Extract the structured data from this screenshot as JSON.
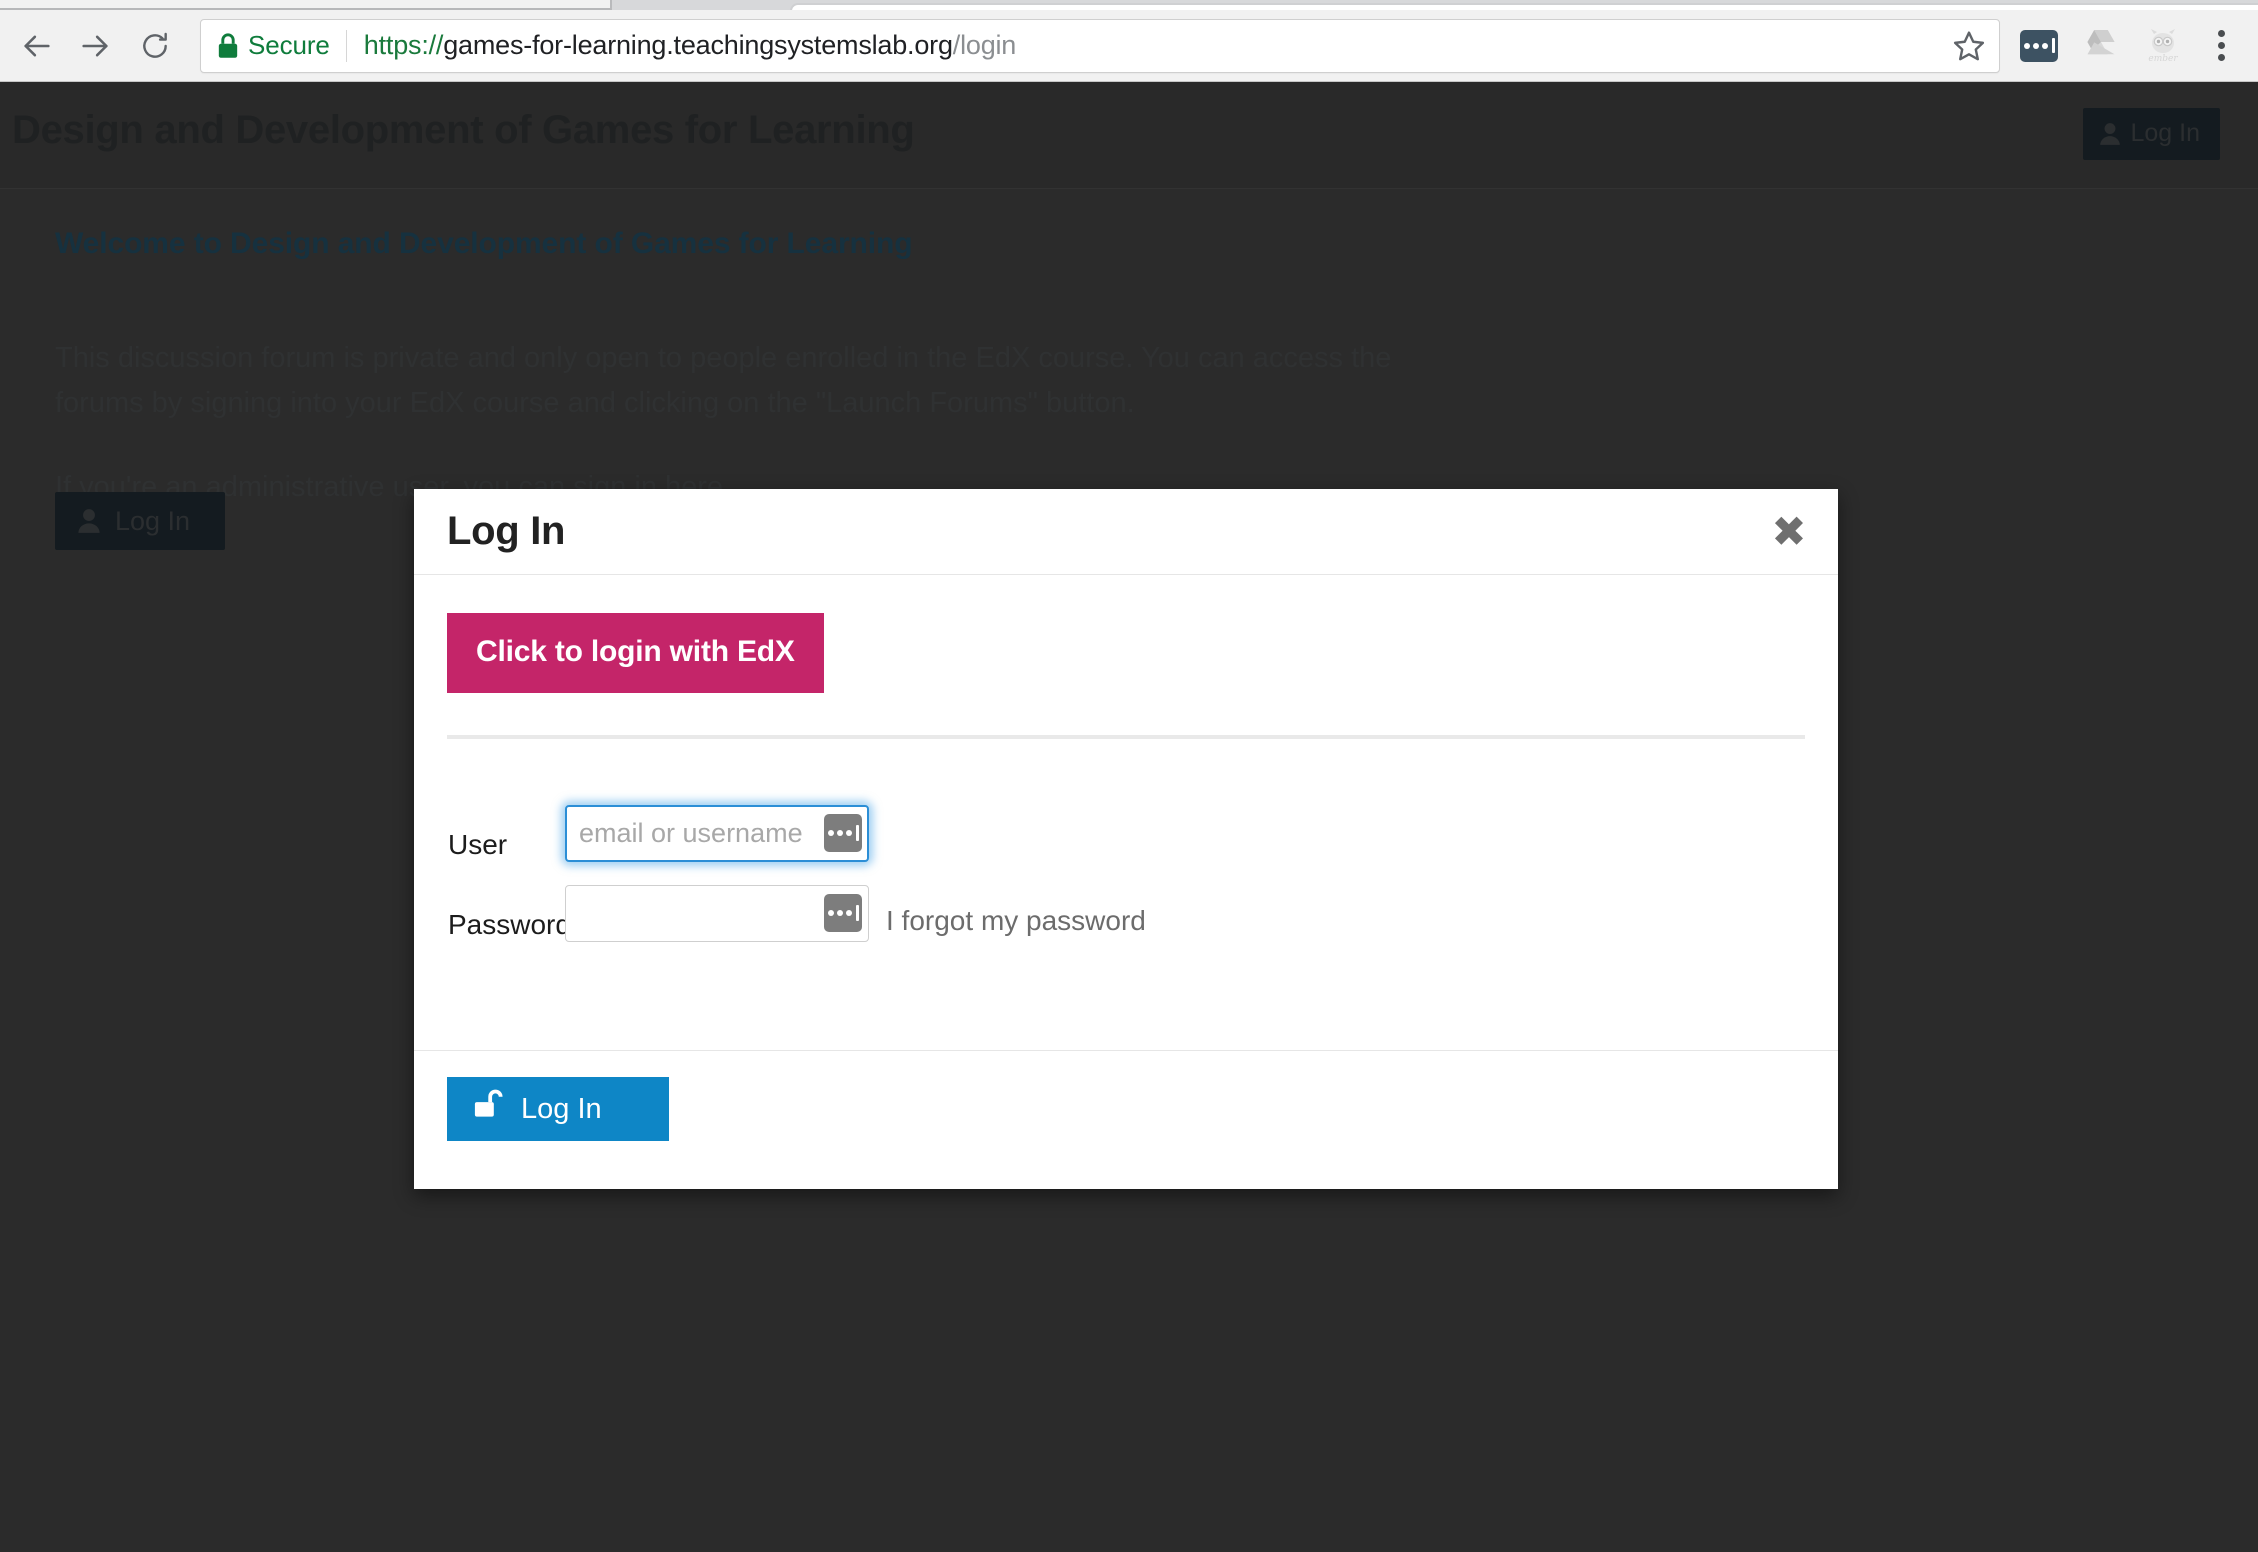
{
  "browser": {
    "back_icon": "arrow-left-icon",
    "forward_icon": "arrow-right-icon",
    "reload_icon": "reload-icon",
    "security_label": "Secure",
    "lock_icon": "lock-icon",
    "url_scheme": "https://",
    "url_host": "games-for-learning.teachingsystemslab.org",
    "url_path": "/login",
    "bookmark_icon": "star-icon",
    "extensions": [
      {
        "name": "password-manager-extension-icon"
      },
      {
        "name": "google-drive-extension-icon"
      },
      {
        "name": "ember-inspector-extension-icon"
      }
    ],
    "menu_icon": "kebab-menu-icon",
    "colors": {
      "secure_green": "#0f7c3c",
      "url_host": "#202124",
      "url_path": "#8b8e91"
    }
  },
  "page": {
    "header": {
      "title": "Design and Development of Games for Learning",
      "login_label": "Log In",
      "login_icon": "person-icon"
    },
    "welcome_heading": "Welcome to Design and Development of Games for Learning",
    "intro_paragraph": "This discussion forum is private and only open to people enrolled in the EdX course. You can access the forums by signing into your EdX course and clicking on the \"Launch Forums\" button.",
    "admin_paragraph": "If you're an administrative user, you can sign in here.",
    "login_label": "Log In",
    "login_icon": "person-icon"
  },
  "modal": {
    "title": "Log In",
    "close_icon": "close-icon",
    "close_glyph": "✖",
    "edx_button_label": "Click to login with EdX",
    "edx_button_color": "#c42569",
    "user": {
      "label": "User",
      "value": "",
      "placeholder": "email or username",
      "badge_icon": "password-manager-icon",
      "focused": true
    },
    "password": {
      "label": "Password",
      "value": "",
      "placeholder": "",
      "badge_icon": "password-manager-icon"
    },
    "forgot_password_label": "I forgot my password",
    "submit_label": "Log In",
    "submit_icon": "unlock-icon",
    "submit_color": "#0e86c6"
  }
}
